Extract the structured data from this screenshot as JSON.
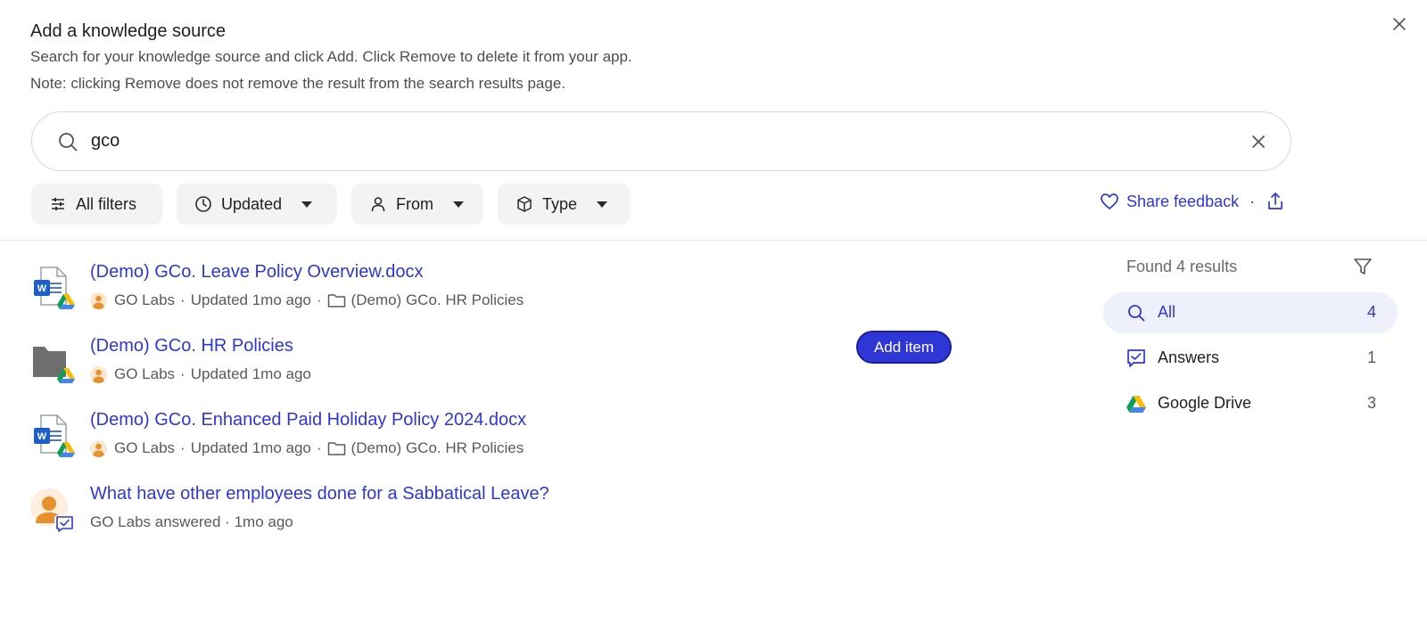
{
  "dialog": {
    "title": "Add a knowledge source",
    "description_line1": "Search for your knowledge source and click Add. Click Remove to delete it from your app.",
    "description_line2": "Note: clicking Remove does not remove the result from the search results page."
  },
  "search": {
    "value": "gco"
  },
  "filters": {
    "all_filters": "All filters",
    "updated": "Updated",
    "from": "From",
    "type": "Type"
  },
  "feedback": {
    "label": "Share feedback",
    "separator": "·"
  },
  "results": [
    {
      "title": "(Demo) GCo. Leave Policy Overview.docx",
      "author": "GO Labs",
      "updated": "Updated 1mo ago",
      "location": "(Demo) GCo. HR Policies",
      "icon": "word-doc-icon"
    },
    {
      "title": "(Demo) GCo. HR Policies",
      "author": "GO Labs",
      "updated": "Updated 1mo ago",
      "icon": "folder-icon"
    },
    {
      "title": "(Demo) GCo. Enhanced Paid Holiday Policy 2024.docx",
      "author": "GO Labs",
      "updated": "Updated 1mo ago",
      "location": "(Demo) GCo. HR Policies",
      "icon": "word-doc-icon"
    },
    {
      "title": "What have other employees done for a Sabbatical Leave?",
      "meta": "GO Labs answered · 1mo ago",
      "icon": "answer-avatar-icon"
    }
  ],
  "add_item_label": "Add item",
  "sidebar": {
    "found_label": "Found 4 results",
    "categories": [
      {
        "label": "All",
        "count": "4",
        "icon": "search-icon"
      },
      {
        "label": "Answers",
        "count": "1",
        "icon": "answers-icon"
      },
      {
        "label": "Google Drive",
        "count": "3",
        "icon": "google-drive-icon"
      }
    ]
  },
  "colors": {
    "link": "#2f36d6",
    "chip_bg": "#f3f3f5",
    "active_bg": "#eef0fb"
  }
}
